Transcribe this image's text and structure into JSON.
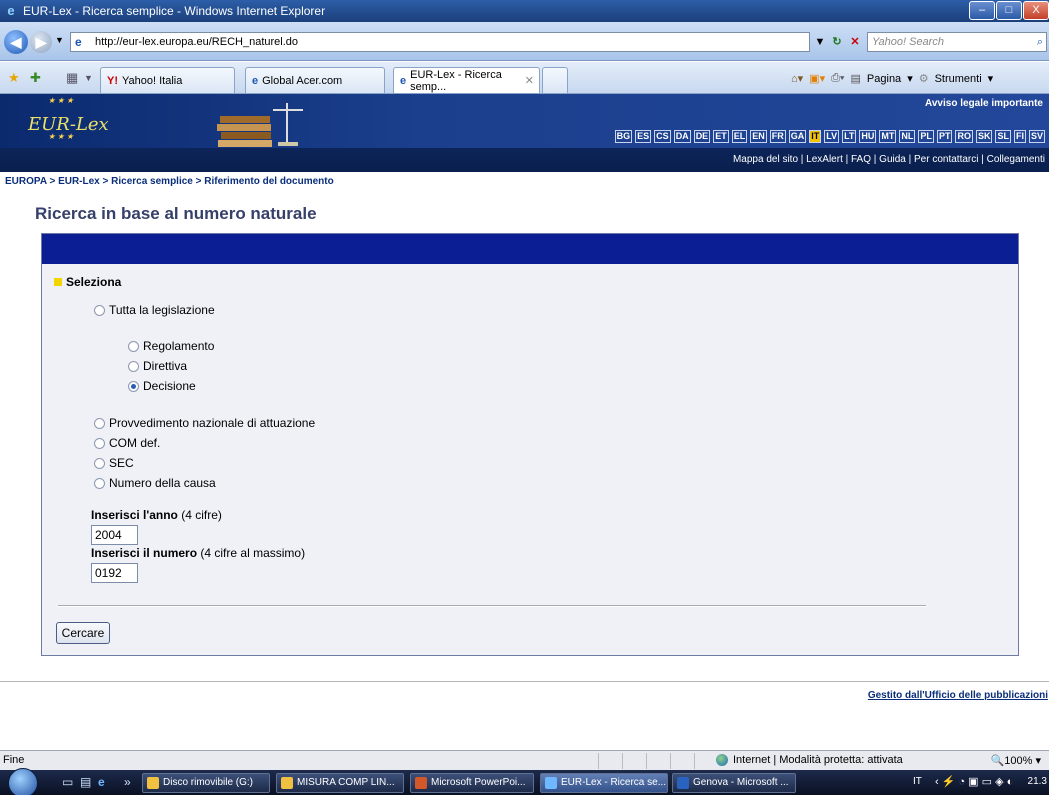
{
  "window": {
    "title": "EUR-Lex - Ricerca semplice - Windows Internet Explorer",
    "min": "–",
    "max": "□",
    "close": "X"
  },
  "address": {
    "url": "http://eur-lex.europa.eu/RECH_naturel.do",
    "search_placeholder": "Yahoo! Search"
  },
  "tabs": [
    {
      "label": "Yahoo! Italia"
    },
    {
      "label": "Global Acer.com"
    },
    {
      "label": "EUR-Lex - Ricerca semp..."
    }
  ],
  "commands": {
    "pagina": "Pagina",
    "strumenti": "Strumenti"
  },
  "site": {
    "avviso": "Avviso legale importante",
    "languages": [
      "BG",
      "ES",
      "CS",
      "DA",
      "DE",
      "ET",
      "EL",
      "EN",
      "FR",
      "GA",
      "IT",
      "LV",
      "LT",
      "HU",
      "MT",
      "NL",
      "PL",
      "PT",
      "RO",
      "SK",
      "SL",
      "FI",
      "SV"
    ],
    "active_language": "IT",
    "toplinks": "Mappa del sito | LexAlert | FAQ | Guida | Per contattarci | Collegamenti",
    "breadcrumb": "EUROPA > EUR-Lex > Ricerca semplice > Riferimento del documento",
    "logo_text": "EUR-Lex"
  },
  "page": {
    "title": "Ricerca in base al numero naturale",
    "seleziona": "Seleziona",
    "options": {
      "tutta": "Tutta la legislazione",
      "regolamento": "Regolamento",
      "direttiva": "Direttiva",
      "decisione": "Decisione",
      "provvedimento": "Provvedimento nazionale di attuazione",
      "com": "COM def.",
      "sec": "SEC",
      "causa": "Numero della causa"
    },
    "anno_label": "Inserisci l'anno",
    "anno_hint": "(4 cifre)",
    "anno_value": "2004",
    "numero_label": "Inserisci il numero",
    "numero_hint": "(4 cifre al massimo)",
    "numero_value": "0192",
    "button": "Cercare",
    "footer_link": "Gestito dall'Ufficio delle pubblicazioni"
  },
  "status": {
    "text": "Fine",
    "zone": "Internet | Modalità protetta: attivata",
    "zoom": "100%"
  },
  "taskbar": {
    "tasks": [
      {
        "label": "Disco rimovibile (G:)"
      },
      {
        "label": "MISURA COMP LIN..."
      },
      {
        "label": "Microsoft PowerPoi..."
      },
      {
        "label": "EUR-Lex - Ricerca se..."
      },
      {
        "label": "Genova - Microsoft ..."
      }
    ],
    "lang": "IT",
    "time": "21.3"
  }
}
